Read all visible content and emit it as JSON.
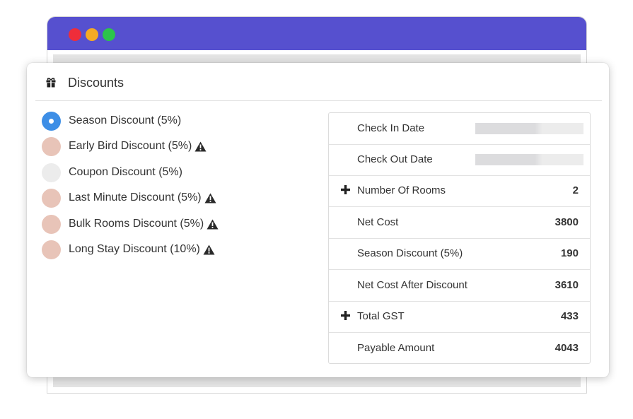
{
  "window": {
    "buttons": [
      "close",
      "minimize",
      "maximize"
    ],
    "colors": {
      "titlebar": "#5650cf",
      "close": "#ef2d3a",
      "minimize": "#f4aa24",
      "maximize": "#2cc44b"
    }
  },
  "panel": {
    "title": "Discounts",
    "icon": "gift-icon"
  },
  "discounts": [
    {
      "label": "Season Discount (5%)",
      "state": "selected",
      "warning": false
    },
    {
      "label": "Early Bird Discount (5%)",
      "state": "unavailable",
      "warning": true
    },
    {
      "label": "Coupon Discount (5%)",
      "state": "available",
      "warning": false
    },
    {
      "label": "Last Minute Discount (5%)",
      "state": "unavailable",
      "warning": true
    },
    {
      "label": "Bulk Rooms Discount (5%)",
      "state": "unavailable",
      "warning": true
    },
    {
      "label": "Long Stay Discount (10%)",
      "state": "unavailable",
      "warning": true
    }
  ],
  "summary": [
    {
      "label": "Check In Date",
      "value": "",
      "expandable": false,
      "redacted": true
    },
    {
      "label": "Check Out Date",
      "value": "",
      "expandable": false,
      "redacted": true
    },
    {
      "label": "Number Of Rooms",
      "value": "2",
      "expandable": true
    },
    {
      "label": "Net Cost",
      "value": "3800",
      "expandable": false
    },
    {
      "label": "Season Discount (5%)",
      "value": "190",
      "expandable": false
    },
    {
      "label": "Net Cost After Discount",
      "value": "3610",
      "expandable": false
    },
    {
      "label": "Total GST",
      "value": "433",
      "expandable": true
    },
    {
      "label": "Payable Amount",
      "value": "4043",
      "expandable": false
    }
  ],
  "colors": {
    "selected_radio": "#3d8ee6",
    "unavailable_radio": "#e8c4b8",
    "available_radio": "#ececec"
  }
}
